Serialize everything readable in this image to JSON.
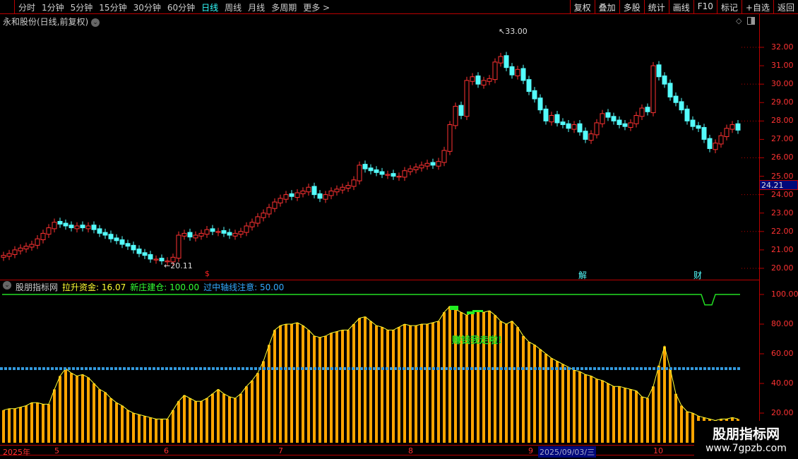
{
  "toolbar": {
    "periods": [
      "分时",
      "1分钟",
      "5分钟",
      "15分钟",
      "30分钟",
      "60分钟",
      "日线",
      "周线",
      "月线",
      "多周期",
      "更多 >"
    ],
    "active": "日线",
    "buttons": [
      "复权",
      "叠加",
      "多股",
      "统计",
      "画线",
      "F10",
      "标记",
      "+自选",
      "返回"
    ]
  },
  "chart": {
    "title": "永和股份(日线,前复权)",
    "high_label": "33.00",
    "low_label": "20.11",
    "last_price": "24.21",
    "y_ticks": [
      "32.00",
      "31.00",
      "30.00",
      "29.00",
      "28.00",
      "27.00",
      "26.00",
      "25.00",
      "24.00",
      "23.00",
      "22.00",
      "21.00",
      "20.00"
    ],
    "markers": {
      "dollar": "$",
      "jie": "解",
      "cai": "财"
    },
    "colors": {
      "up": "#ff3232",
      "down": "#54fcfc"
    },
    "closes": [
      20.7,
      20.8,
      21.0,
      21.1,
      21.2,
      21.3,
      21.6,
      21.9,
      22.2,
      22.5,
      22.4,
      22.3,
      22.2,
      22.3,
      22.2,
      22.3,
      22.1,
      21.9,
      21.8,
      21.6,
      21.5,
      21.3,
      21.2,
      21.0,
      20.8,
      20.7,
      20.5,
      20.5,
      20.4,
      20.4,
      20.6,
      21.8,
      21.9,
      21.7,
      21.8,
      21.9,
      22.1,
      22.0,
      22.0,
      21.9,
      21.8,
      21.9,
      22.0,
      22.3,
      22.5,
      22.8,
      23.0,
      23.3,
      23.6,
      23.8,
      24.0,
      23.9,
      24.1,
      24.2,
      24.4,
      24.0,
      23.8,
      24.0,
      24.2,
      24.3,
      24.4,
      24.5,
      24.8,
      25.6,
      25.4,
      25.3,
      25.2,
      25.1,
      25.1,
      25.0,
      25.0,
      25.3,
      25.4,
      25.5,
      25.6,
      25.7,
      25.6,
      25.8,
      26.4,
      27.8,
      28.8,
      28.3,
      30.2,
      30.4,
      30.0,
      30.2,
      30.3,
      31.2,
      31.5,
      30.9,
      30.5,
      30.8,
      30.2,
      29.6,
      29.2,
      28.6,
      28.0,
      28.3,
      27.9,
      27.8,
      27.6,
      27.8,
      27.4,
      27.0,
      27.3,
      27.9,
      28.4,
      28.2,
      28.0,
      27.8,
      27.7,
      27.9,
      28.3,
      28.7,
      28.5,
      31.0,
      30.4,
      30.0,
      29.3,
      29.0,
      28.6,
      28.0,
      27.7,
      27.6,
      27.0,
      26.5,
      26.8,
      27.2,
      27.6,
      27.8,
      27.5
    ]
  },
  "indicator": {
    "name": "股朋指标网",
    "lines": [
      {
        "label": "拉升资金: 16.07",
        "color": "#ffff33"
      },
      {
        "label": "新庄建仓: 100.00",
        "color": "#33ff33"
      },
      {
        "label": "过中轴线注意: 50.00",
        "color": "#33aaff"
      }
    ],
    "y_ticks": [
      "100.00",
      "80.00",
      "60.00",
      "40.00",
      "20.00"
    ],
    "signal_text": "赚钱我走啦!",
    "bar_color": "#ffa500",
    "values": [
      22,
      23,
      23,
      24,
      25,
      27,
      27,
      26,
      26,
      36,
      45,
      50,
      47,
      45,
      46,
      44,
      40,
      36,
      34,
      30,
      27,
      25,
      22,
      20,
      19,
      18,
      17,
      16,
      16,
      16,
      22,
      28,
      32,
      30,
      28,
      28,
      30,
      33,
      36,
      33,
      31,
      30,
      33,
      38,
      42,
      47,
      55,
      66,
      76,
      79,
      80,
      80,
      81,
      79,
      76,
      72,
      71,
      72,
      74,
      75,
      76,
      76,
      80,
      84,
      85,
      82,
      79,
      78,
      76,
      76,
      78,
      80,
      79,
      79,
      80,
      80,
      81,
      82,
      88,
      92,
      90,
      88,
      86,
      88,
      89,
      88,
      89,
      86,
      82,
      80,
      82,
      78,
      72,
      68,
      66,
      63,
      60,
      57,
      55,
      53,
      51,
      49,
      48,
      46,
      45,
      43,
      42,
      40,
      38,
      38,
      37,
      36,
      35,
      31,
      30,
      38,
      52,
      65,
      50,
      33,
      25,
      21,
      20,
      18,
      17,
      16,
      15,
      16,
      16,
      17,
      16
    ]
  },
  "dates": {
    "year": "2025年",
    "months": [
      "5",
      "6",
      "7",
      "8",
      "9",
      "10"
    ],
    "selected": "2025/09/03/三"
  },
  "watermark": {
    "name": "股朋指标网",
    "url": "www.7gpzb.com"
  }
}
